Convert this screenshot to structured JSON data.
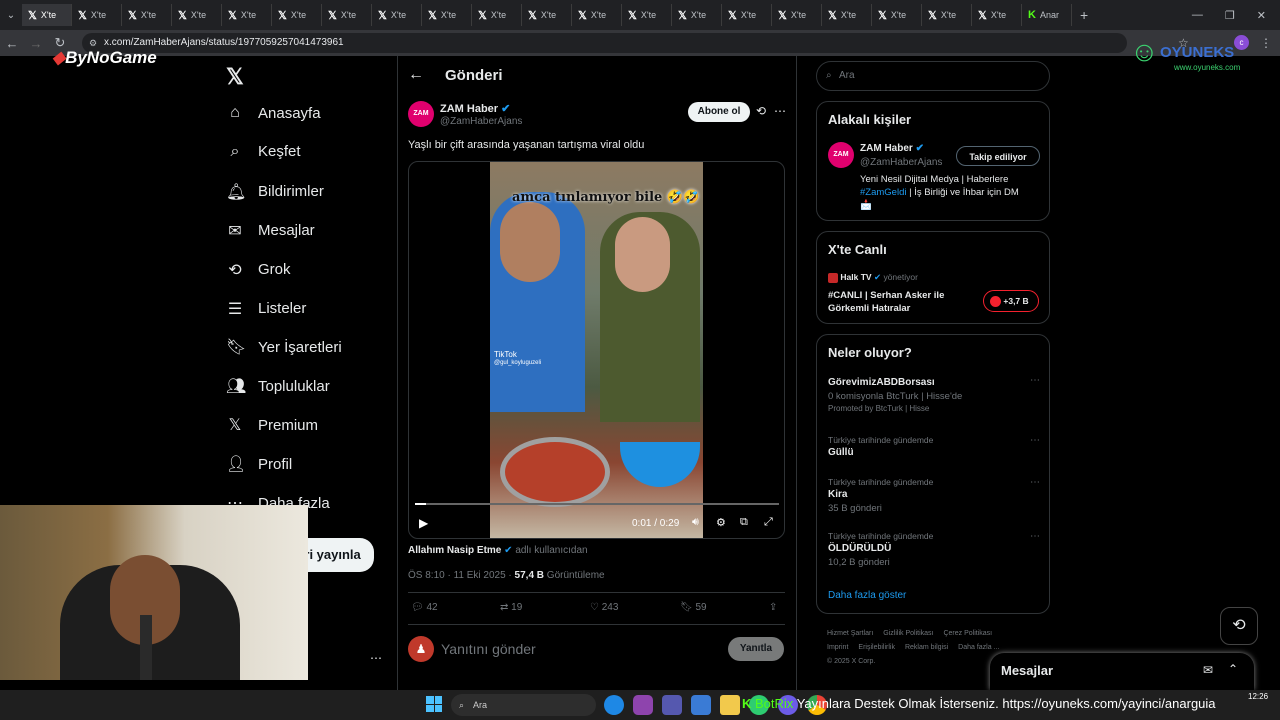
{
  "tabs": [
    "X'te",
    "X'te",
    "X'te",
    "X'te",
    "X'te",
    "X'te",
    "X'te",
    "X'te",
    "X'te",
    "X'te",
    "X'te",
    "X'te",
    "X'te",
    "X'te",
    "X'te",
    "X'te",
    "X'te",
    "X'te",
    "X'te",
    "X'te",
    "Anar"
  ],
  "url": "x.com/ZamHaberAjans/status/1977059257041473961",
  "overlay": {
    "brand": "ByNoGame",
    "site": "OYUNEKS",
    "site_sub": "www.oyuneks.com"
  },
  "nav": [
    "Anasayfa",
    "Keşfet",
    "Bildirimler",
    "Mesajlar",
    "Grok",
    "Listeler",
    "Yer İşaretleri",
    "Topluluklar",
    "Premium",
    "Profil",
    "Daha fazla"
  ],
  "post_button": "Gönderi yayınla",
  "header": {
    "title": "Gönderi"
  },
  "post": {
    "author": "ZAM Haber",
    "handle": "@ZamHaberAjans",
    "subscribe": "Abone ol",
    "text": "Yaşlı bir çift arasında yaşanan tartışma viral oldu",
    "video_caption": "amca tınlamıyor bile 🤣🤣",
    "video_time": "0:01 / 0:29",
    "tiktok": "TikTok",
    "tiktok_user": "@gul_koyluguzeli",
    "attrib_name": "Allahım Nasip Etme",
    "attrib_suffix": "adlı kullanıcıdan",
    "date": "ÖS 8:10 · 11 Eki 2025 ·",
    "views": "57,4 B",
    "views_label": "Görüntüleme",
    "replies": "42",
    "reposts": "19",
    "likes": "243",
    "bookmarks": "59",
    "reply_placeholder": "Yanıtını gönder",
    "reply_button": "Yanıtla"
  },
  "search": {
    "placeholder": "Ara"
  },
  "related": {
    "title": "Alakalı kişiler",
    "name": "ZAM Haber",
    "handle": "@ZamHaberAjans",
    "follow": "Takip ediliyor",
    "bio1": "Yeni Nesil Dijital Medya | Haberlere",
    "bio_tag": "#ZamGeldi",
    "bio2": " | İş Birliği ve İhbar için DM",
    "bio3": "📩"
  },
  "live": {
    "title": "X'te Canlı",
    "host": "Halk TV",
    "host_suffix": "yönetiyor",
    "topic": "#CANLI | Serhan Asker ile Görkemli Hatıralar",
    "count": "+3,7 B"
  },
  "trends": {
    "title": "Neler oluyor?",
    "items": [
      {
        "cat": "",
        "name": "GörevimizABDBorsası",
        "sub": "0 komisyonla BtcTurk | Hisse'de",
        "promo": "Promoted by BtcTurk | Hisse"
      },
      {
        "cat": "Türkiye tarihinde gündemde",
        "name": "Güllü",
        "sub": "",
        "promo": ""
      },
      {
        "cat": "Türkiye tarihinde gündemde",
        "name": "Kira",
        "sub": "35 B gönderi",
        "promo": ""
      },
      {
        "cat": "Türkiye tarihinde gündemde",
        "name": "ÖLDÜRÜLDÜ",
        "sub": "10,2 B gönderi",
        "promo": ""
      }
    ],
    "more": "Daha fazla göster"
  },
  "footer": {
    "l1": [
      "Hizmet Şartları",
      "Gizlilik Politikası",
      "Çerez Politikası"
    ],
    "l2": [
      "Imprint",
      "Erişilebilirlik",
      "Reklam bilgisi",
      "Daha fazla ..."
    ],
    "copy": "© 2025 X Corp."
  },
  "messages": {
    "title": "Mesajlar"
  },
  "taskbar": {
    "search": "Ara",
    "ticker": "Yayınlara Destek Olmak İsterseniz. https://oyuneks.com/yayinci/anarguia",
    "bot": "BotRix",
    "time": "12:26"
  }
}
